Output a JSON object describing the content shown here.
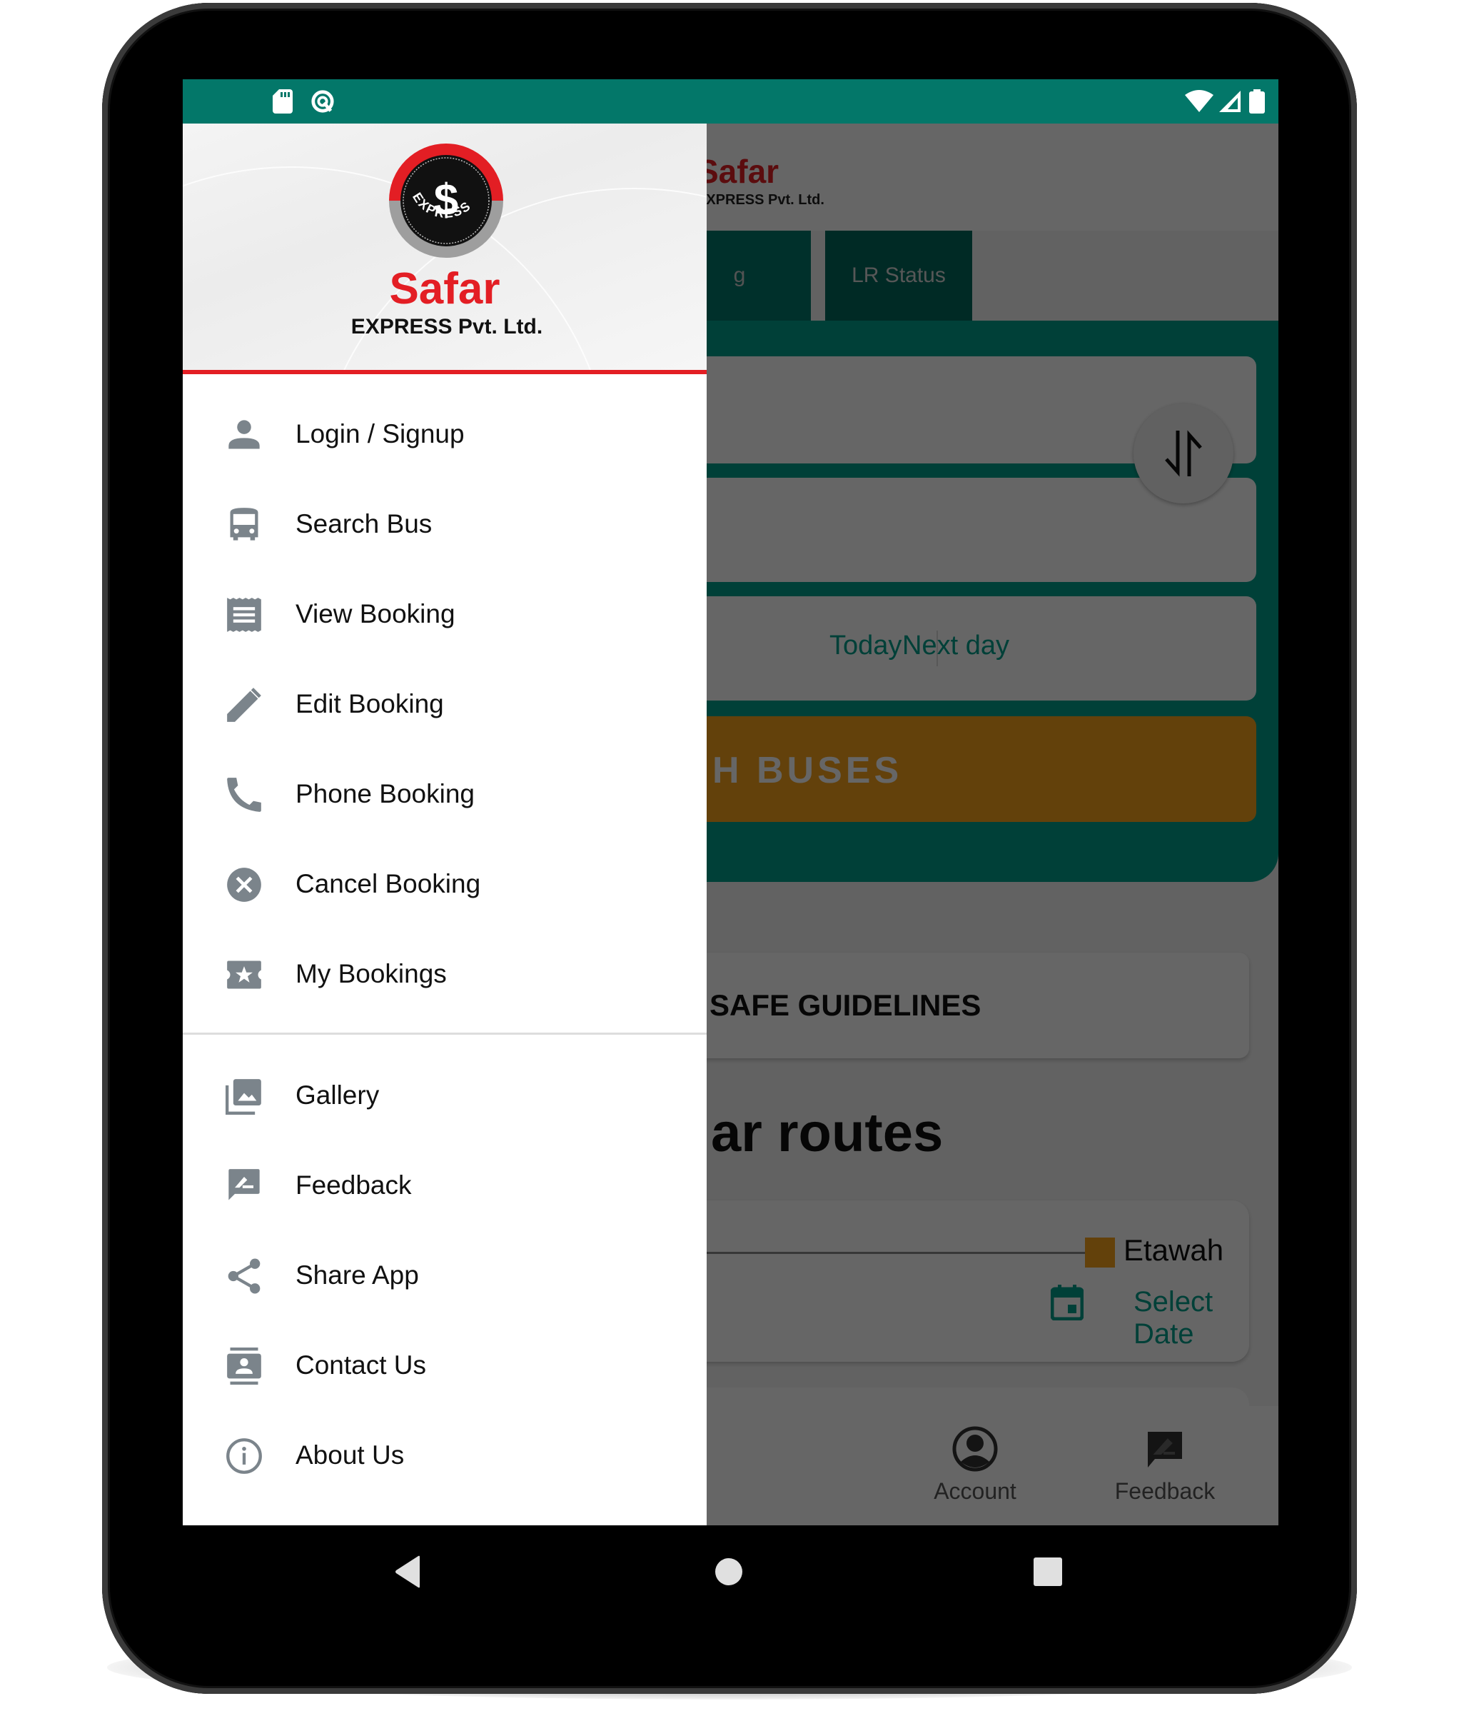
{
  "status_bar": {
    "left_icons": [
      "sd-card-icon",
      "sync-icon"
    ],
    "right_icons": [
      "wifi-icon",
      "cell-signal-icon",
      "battery-icon"
    ],
    "color": "#037769"
  },
  "drawer": {
    "brand": {
      "name": "Safar",
      "subtitle": "EXPRESS Pvt. Ltd.",
      "logo_text": "EXPRESS",
      "logo_symbol": "$"
    },
    "primary_items": [
      {
        "label": "Login / Signup",
        "icon": "person-icon"
      },
      {
        "label": "Search Bus",
        "icon": "bus-icon"
      },
      {
        "label": "View Booking",
        "icon": "receipt-icon"
      },
      {
        "label": "Edit Booking",
        "icon": "pencil-icon"
      },
      {
        "label": "Phone Booking",
        "icon": "phone-icon"
      },
      {
        "label": "Cancel Booking",
        "icon": "cancel-icon"
      },
      {
        "label": "My Bookings",
        "icon": "ticket-icon"
      }
    ],
    "secondary_items": [
      {
        "label": "Gallery",
        "icon": "gallery-icon"
      },
      {
        "label": "Feedback",
        "icon": "feedback-icon"
      },
      {
        "label": "Share App",
        "icon": "share-icon"
      },
      {
        "label": "Contact Us",
        "icon": "contact-icon"
      },
      {
        "label": "About Us",
        "icon": "info-icon"
      }
    ]
  },
  "app": {
    "header": {
      "title": "Safar",
      "subtitle": "EXPRESS Pvt. Ltd."
    },
    "tabs": [
      {
        "label": "g",
        "active": false
      },
      {
        "label": "LR Status",
        "active": true
      }
    ],
    "date_options": {
      "today": "Today",
      "next_day": "Next day"
    },
    "search_button": "H BUSES",
    "guidelines": "SAFE GUIDELINES",
    "popular_routes_title": "ar routes",
    "route": {
      "destination": "Etawah",
      "select_date": "Select Date"
    },
    "bottom_nav": [
      {
        "label": "Account",
        "icon": "account-icon"
      },
      {
        "label": "Feedback",
        "icon": "feedback-icon"
      }
    ]
  },
  "colors": {
    "brand_red": "#e31e24",
    "teal": "#00a18d",
    "accent_orange": "#f7a41d",
    "icon_gray": "#7b848b"
  }
}
